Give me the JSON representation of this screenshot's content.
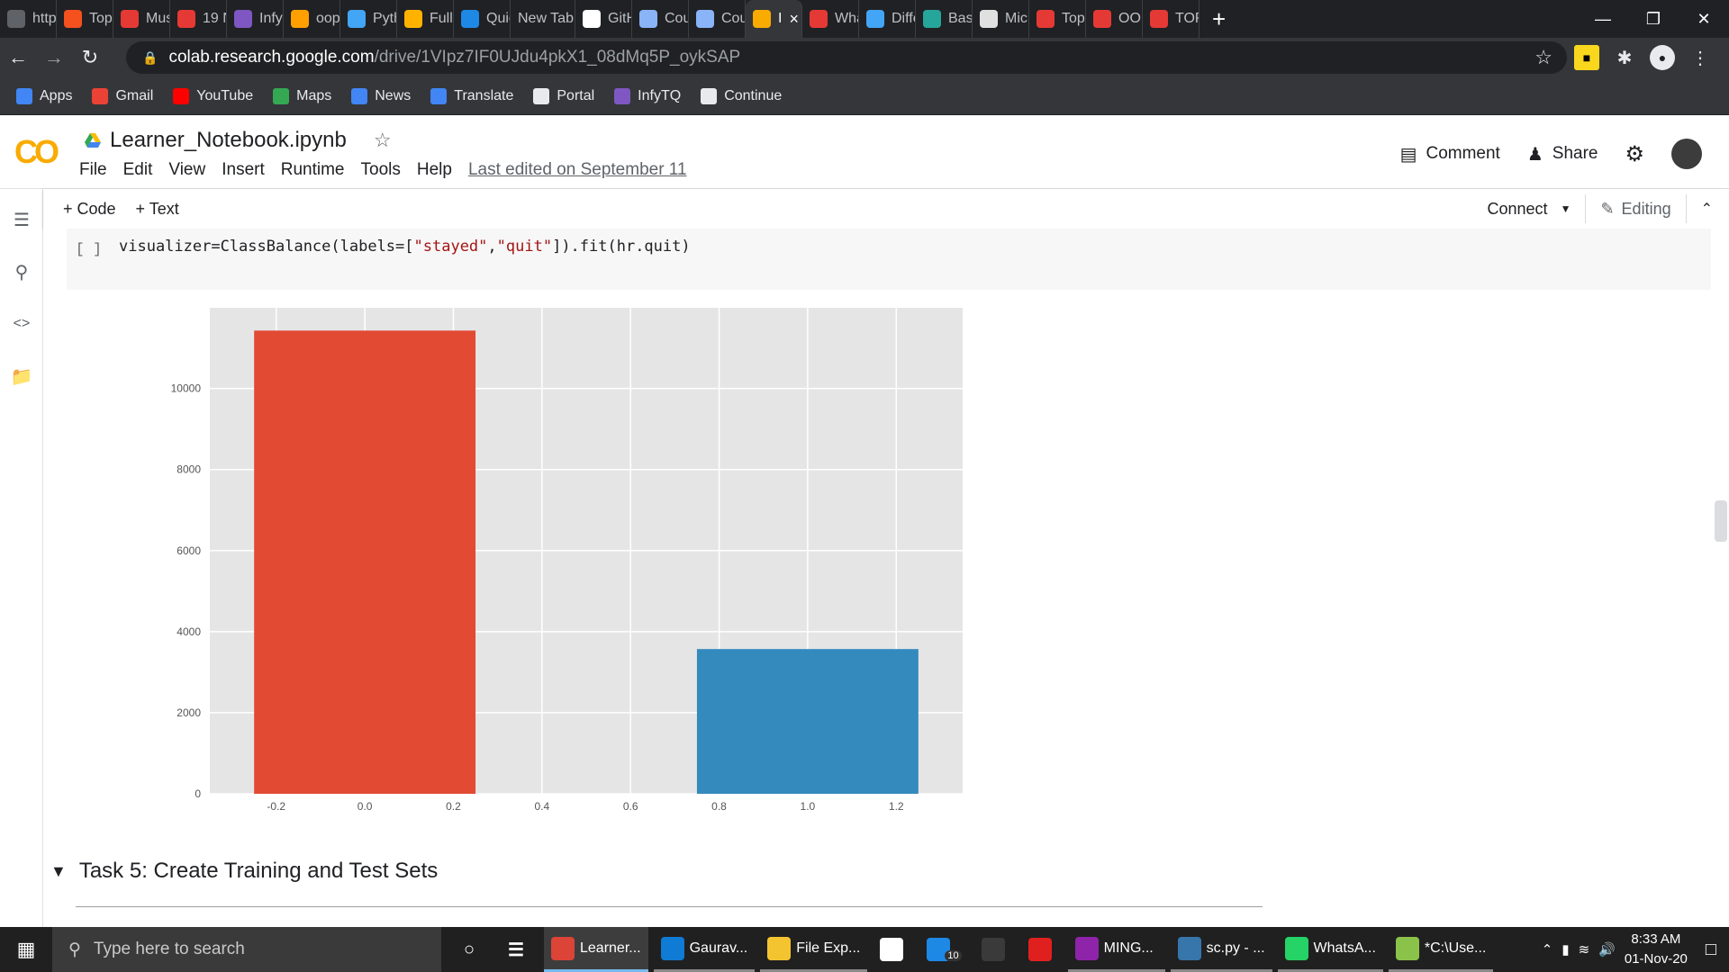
{
  "browser": {
    "tabs": [
      {
        "label": "http",
        "icon": "globe-icon",
        "color": "#5f6368"
      },
      {
        "label": "Top",
        "icon": "orange-circle-icon",
        "color": "#f4511e"
      },
      {
        "label": "Mus",
        "icon": "red-flag-icon",
        "color": "#e53935"
      },
      {
        "label": "19 N",
        "icon": "red-flag-icon",
        "color": "#e53935"
      },
      {
        "label": "Infy",
        "icon": "infy-icon",
        "color": "#7e57c2"
      },
      {
        "label": "oop",
        "icon": "hand-icon",
        "color": "#ffa000"
      },
      {
        "label": "Pyth",
        "icon": "ib-icon",
        "color": "#42a5f5"
      },
      {
        "label": "FullS",
        "icon": "battery-icon",
        "color": "#ffb300"
      },
      {
        "label": "Quic",
        "icon": "wave-icon",
        "color": "#1e88e5"
      },
      {
        "label": "New Tab",
        "icon": "",
        "color": "#202124"
      },
      {
        "label": "GitH",
        "icon": "github-icon",
        "color": "#ffffff"
      },
      {
        "label": "Cou",
        "icon": "colab-icon",
        "color": "#8ab4f8"
      },
      {
        "label": "Cou",
        "icon": "colab-icon",
        "color": "#8ab4f8"
      },
      {
        "label": "I",
        "icon": "colab-icon",
        "color": "#f9ab00"
      },
      {
        "label": "Wha",
        "icon": "bolt-icon",
        "color": "#e53935"
      },
      {
        "label": "Diffe",
        "icon": "bulb-icon",
        "color": "#42a5f5"
      },
      {
        "label": "Basi",
        "icon": "tree-icon",
        "color": "#26a69a"
      },
      {
        "label": "Micr",
        "icon": "bird-icon",
        "color": "#e0e0e0"
      },
      {
        "label": "Top",
        "icon": "v-icon",
        "color": "#e53935"
      },
      {
        "label": "OOI",
        "icon": "stripe-icon",
        "color": "#e53935"
      },
      {
        "label": "TOP",
        "icon": "job-icon",
        "color": "#e53935"
      }
    ],
    "url_host": "colab.research.google.com",
    "url_path": "/drive/1VIpz7IF0UJdu4pkX1_08dMq5P_oykSAP",
    "bookmarks": [
      {
        "label": "Apps",
        "icon": "apps-grid-icon"
      },
      {
        "label": "Gmail",
        "icon": "gmail-icon"
      },
      {
        "label": "YouTube",
        "icon": "youtube-icon"
      },
      {
        "label": "Maps",
        "icon": "maps-icon"
      },
      {
        "label": "News",
        "icon": "news-icon"
      },
      {
        "label": "Translate",
        "icon": "translate-icon"
      },
      {
        "label": "Portal",
        "icon": "globe-icon"
      },
      {
        "label": "InfyTQ",
        "icon": "infy-icon"
      },
      {
        "label": "Continue",
        "icon": "globe-icon"
      }
    ]
  },
  "colab": {
    "logo": "CO",
    "title": "Learner_Notebook.ipynb",
    "menu": [
      "File",
      "Edit",
      "View",
      "Insert",
      "Runtime",
      "Tools",
      "Help"
    ],
    "last_edited": "Last edited on September 11",
    "comment_label": "Comment",
    "share_label": "Share",
    "add_code": "+ Code",
    "add_text": "+ Text",
    "connect_label": "Connect",
    "editing_label": "Editing",
    "cell_bracket": "[ ]",
    "code_prefix": "visualizer=ClassBalance(labels=[",
    "code_str1": "\"stayed\"",
    "code_comma": ",",
    "code_str2": "\"quit\"",
    "code_suffix": "]).fit(hr.quit)",
    "section_heading": "Task 5: Create Training and Test Sets"
  },
  "chart_data": {
    "type": "bar",
    "x": [
      0.0,
      1.0
    ],
    "values": [
      11428,
      3571
    ],
    "colors": [
      "#e24a33",
      "#348abd"
    ],
    "bar_width": 0.5,
    "xlim": [
      -0.35,
      1.35
    ],
    "ylim": [
      0,
      11990
    ],
    "xticks": [
      "-0.2",
      "0.0",
      "0.2",
      "0.4",
      "0.6",
      "0.8",
      "1.0",
      "1.2"
    ],
    "xtick_values": [
      -0.2,
      0.0,
      0.2,
      0.4,
      0.6,
      0.8,
      1.0,
      1.2
    ],
    "yticks": [
      "0",
      "2000",
      "4000",
      "6000",
      "8000",
      "10000"
    ],
    "ytick_values": [
      0,
      2000,
      4000,
      6000,
      8000,
      10000
    ],
    "grid": true,
    "background": "#e5e5e5"
  },
  "taskbar": {
    "search_placeholder": "Type here to search",
    "items": [
      {
        "label": "",
        "icon": "cortana-icon",
        "active": false
      },
      {
        "label": "",
        "icon": "task-view-icon",
        "active": false
      },
      {
        "label": "Learner...",
        "icon": "chrome-icon",
        "active": true
      },
      {
        "label": "Gaurav...",
        "icon": "edge-icon",
        "active": false
      },
      {
        "label": "File Exp...",
        "icon": "folder-icon",
        "active": false
      },
      {
        "label": "",
        "icon": "store-icon",
        "active": false
      },
      {
        "label": "",
        "icon": "mail-icon",
        "active": false
      },
      {
        "label": "",
        "icon": "app-icon",
        "active": false
      },
      {
        "label": "",
        "icon": "opera-icon",
        "active": false
      },
      {
        "label": "MING...",
        "icon": "git-icon",
        "active": false
      },
      {
        "label": "sc.py - ...",
        "icon": "python-file-icon",
        "active": false
      },
      {
        "label": "WhatsA...",
        "icon": "whatsapp-icon",
        "active": false
      },
      {
        "label": "*C:\\Use...",
        "icon": "notepad-icon",
        "active": false
      }
    ],
    "mail_badge": "10",
    "time": "8:33 AM",
    "date": "01-Nov-20"
  }
}
